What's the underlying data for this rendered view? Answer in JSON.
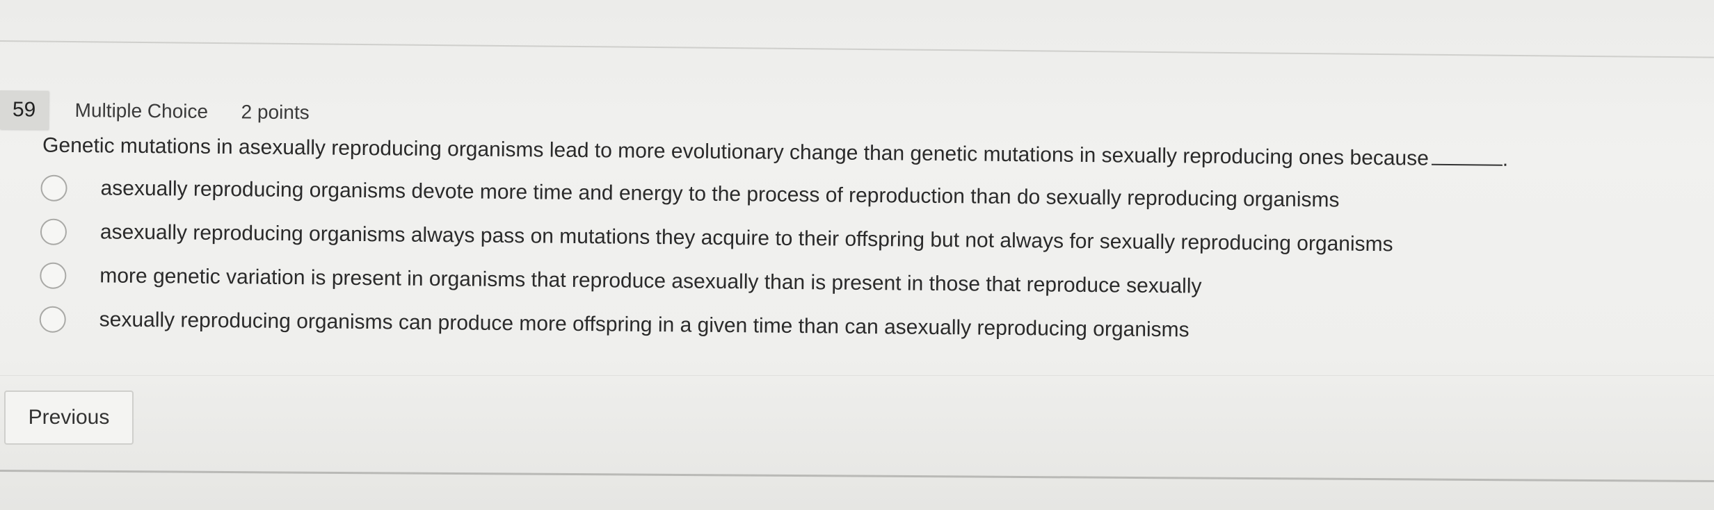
{
  "question": {
    "number": "59",
    "type": "Multiple Choice",
    "points": "2 points",
    "text": "Genetic mutations in asexually reproducing organisms lead to more evolutionary change than genetic mutations in sexually reproducing ones because",
    "suffix": "."
  },
  "options": [
    {
      "label": "asexually reproducing organisms devote more time and energy to the process of reproduction than do sexually reproducing organisms"
    },
    {
      "label": "asexually reproducing organisms always pass on mutations they acquire to their offspring but not always for sexually reproducing organisms"
    },
    {
      "label": "more genetic variation is present in organisms that reproduce asexually than is present in those that reproduce sexually"
    },
    {
      "label": "sexually reproducing organisms can produce more offspring in a given time than can asexually reproducing organisms"
    }
  ],
  "navigation": {
    "previous_label": "Previous"
  }
}
